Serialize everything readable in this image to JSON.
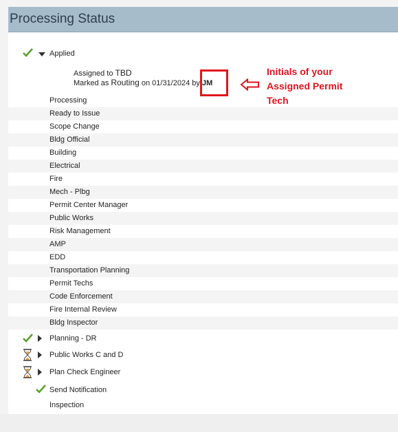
{
  "header": {
    "title": "Processing Status"
  },
  "applied": {
    "label": "Applied",
    "assigned_prefix": "Assigned to",
    "assigned_value": "TBD",
    "marked_prefix": "Marked as",
    "marked_value": "Routing",
    "on_text": "on 01/31/2024",
    "by_text": "by",
    "initials": "JM"
  },
  "tasks": [
    "Processing",
    "Ready to Issue",
    "Scope Change",
    "Bldg Official",
    "Building",
    "Electrical",
    "Fire",
    "Mech - Plbg",
    "Permit Center Manager",
    "Public Works",
    "Risk Management",
    "AMP",
    "EDD",
    "Transportation Planning",
    "Permit Techs",
    "Code Enforcement",
    "Fire Internal Review",
    "Bldg Inspector"
  ],
  "groups": [
    {
      "label": "Planning - DR",
      "status": "complete"
    },
    {
      "label": "Public Works C and D",
      "status": "pending"
    },
    {
      "label": "Plan Check Engineer",
      "status": "pending"
    }
  ],
  "send_notification": {
    "label": "Send Notification",
    "status": "complete"
  },
  "inspection": {
    "label": "Inspection"
  },
  "annotation": {
    "line1": "Initials of your",
    "line2": "Assigned Permit",
    "line3": "Tech"
  },
  "colors": {
    "check": "#5aa02c",
    "annotation": "#e0151d",
    "header": "#a7bccb"
  }
}
